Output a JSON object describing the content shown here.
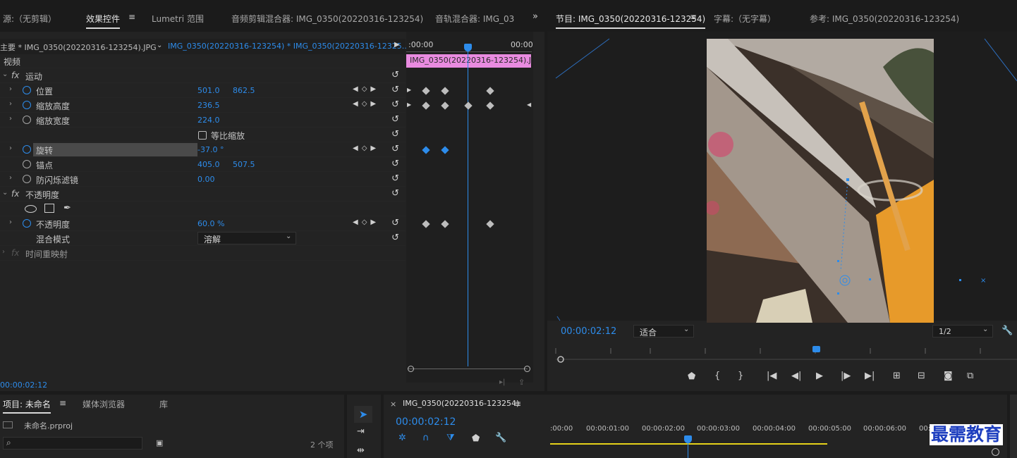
{
  "top_tabs": {
    "source": "源:（无剪辑）",
    "effect_controls": "效果控件",
    "lumetri": "Lumetri 范围",
    "audio_clip_mixer": "音频剪辑混合器: IMG_0350(20220316-123254)",
    "audio_track_mixer": "音轨混合器: IMG_03",
    "program": "节目: IMG_0350(20220316-123254)",
    "captions": "字幕:（无字幕）",
    "reference": "参考: IMG_0350(20220316-123254)"
  },
  "ec": {
    "master": "主要 * IMG_0350(20220316-123254).JPG",
    "clip": "IMG_0350(20220316-123254) * IMG_0350(20220316-12325...",
    "time_left": ":00:00",
    "time_right": "00:00",
    "clip_bar": "IMG_0350(20220316-123254).JPG",
    "video_header": "视频",
    "motion": "运动",
    "position": "位置",
    "position_x": "501.0",
    "position_y": "862.5",
    "scale_h": "缩放高度",
    "scale_h_val": "236.5",
    "scale_w": "缩放宽度",
    "scale_w_val": "224.0",
    "uniform": "等比缩放",
    "rotation": "旋转",
    "rotation_val": "-37.0 °",
    "anchor": "锚点",
    "anchor_x": "405.0",
    "anchor_y": "507.5",
    "flicker": "防闪烁滤镜",
    "flicker_val": "0.00",
    "opacity_header": "不透明度",
    "opacity": "不透明度",
    "opacity_val": "60.0 %",
    "blend": "混合模式",
    "blend_val": "溶解",
    "time_remap": "时间重映射",
    "timecode": "00:00:02:12"
  },
  "program": {
    "timecode": "00:00:02:12",
    "fit": "适合",
    "resolution": "1/2"
  },
  "project": {
    "tab": "项目: 未命名",
    "media_browser": "媒体浏览器",
    "library": "库",
    "file": "未命名.prproj",
    "count": "2 个项"
  },
  "timeline": {
    "close": "×",
    "seq": "IMG_0350(20220316-123254)",
    "timecode": "00:00:02:12",
    "ticks": [
      ":00:00",
      "00:00:01:00",
      "00:00:02:00",
      "00:00:03:00",
      "00:00:04:00",
      "00:00:05:00",
      "00:00:06:00",
      "00:00"
    ]
  },
  "watermark": "最需教育",
  "colors": {
    "accent": "#2d8ceb",
    "clip": "#e98be0",
    "yellow": "#e6d11a"
  }
}
